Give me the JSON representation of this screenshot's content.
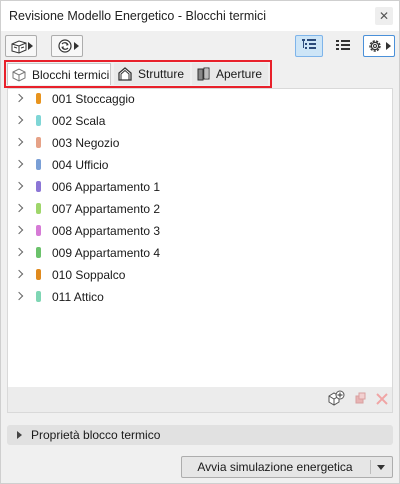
{
  "window": {
    "title": "Revisione Modello Energetico - Blocchi termici",
    "close_glyph": "✕"
  },
  "toolbar": {
    "buttons": [
      {
        "name": "model-display-dropdown",
        "icon": "building-icon"
      },
      {
        "name": "refresh-dropdown",
        "icon": "refresh-icon"
      },
      {
        "name": "list-view",
        "icon": "tree-list-icon",
        "active": true
      },
      {
        "name": "flat-list-view",
        "icon": "list-icon",
        "active": false
      },
      {
        "name": "settings-dropdown",
        "icon": "gear-icon"
      }
    ]
  },
  "tabs": [
    {
      "label": "Blocchi termici",
      "icon": "thermal-block-icon",
      "active": true
    },
    {
      "label": "Strutture",
      "icon": "house-icon",
      "active": false
    },
    {
      "label": "Aperture",
      "icon": "door-icon",
      "active": false
    }
  ],
  "zones": [
    {
      "label": "001 Stoccaggio",
      "color": "#e8941e"
    },
    {
      "label": "002 Scala",
      "color": "#7fd6d6"
    },
    {
      "label": "003 Negozio",
      "color": "#e6a287"
    },
    {
      "label": "004 Ufficio",
      "color": "#7a9fd6"
    },
    {
      "label": "006 Appartamento 1",
      "color": "#8c76d6"
    },
    {
      "label": "007 Appartamento 2",
      "color": "#9fd66b"
    },
    {
      "label": "008 Appartamento 3",
      "color": "#d67bd6"
    },
    {
      "label": "009 Appartamento 4",
      "color": "#6bc26b"
    },
    {
      "label": "010 Soppalco",
      "color": "#e08a1e"
    },
    {
      "label": "011 Attico",
      "color": "#7fd6b4"
    }
  ],
  "footer_buttons": [
    {
      "name": "add-block",
      "icon": "add-block-icon",
      "enabled": true
    },
    {
      "name": "duplicate-block",
      "icon": "duplicate-icon",
      "enabled": false
    },
    {
      "name": "delete-block",
      "icon": "delete-icon",
      "enabled": false
    }
  ],
  "properties": {
    "label": "Proprietà blocco termico"
  },
  "actions": {
    "run_label": "Avvia simulazione energetica"
  },
  "colors": {
    "accent": "#4a90d9",
    "highlight_outline": "#e8202a"
  }
}
